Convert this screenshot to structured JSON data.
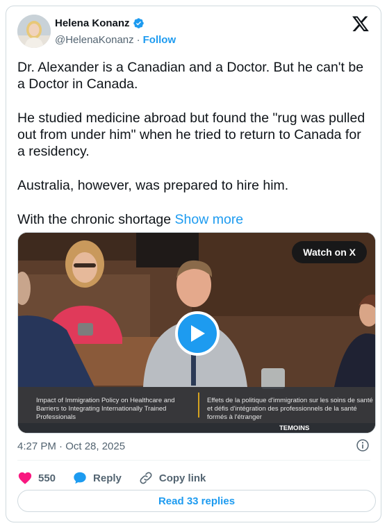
{
  "author": {
    "display_name": "Helena Konanz",
    "handle": "@HelenaKonanz",
    "separator": "·",
    "follow_label": "Follow",
    "verified_color": "#1d9bf0",
    "avatar_icon": "user-avatar"
  },
  "tweet": {
    "paragraphs": [
      "Dr. Alexander is a Canadian and a Doctor. But he can't be a Doctor in Canada.",
      "He studied medicine abroad but found the \"rug was pulled out from under him\" when he tried to return to Canada for a residency.",
      "Australia, however, was prepared to hire him."
    ],
    "last_line": "With the chronic shortage ",
    "show_more": "Show more"
  },
  "media": {
    "watch_label": "Watch on X",
    "caption_en": "Impact of Immigration Policy on Healthcare and Barriers to Integrating Internationally Trained Professionals",
    "caption_fr": "Effets de la politique d'immigration sur les soins de santé et défis d'intégration des professionnels de la santé formés à l'étranger",
    "bottom_label": "TEMOINS"
  },
  "meta": {
    "timestamp": "4:27 PM · Oct 28, 2025"
  },
  "actions": {
    "likes": "550",
    "reply_label": "Reply",
    "copy_link_label": "Copy link"
  },
  "replies_button": "Read 33 replies",
  "colors": {
    "accent": "#1d9bf0",
    "like": "#f91880",
    "text": "#0f1419",
    "secondary": "#536471"
  }
}
